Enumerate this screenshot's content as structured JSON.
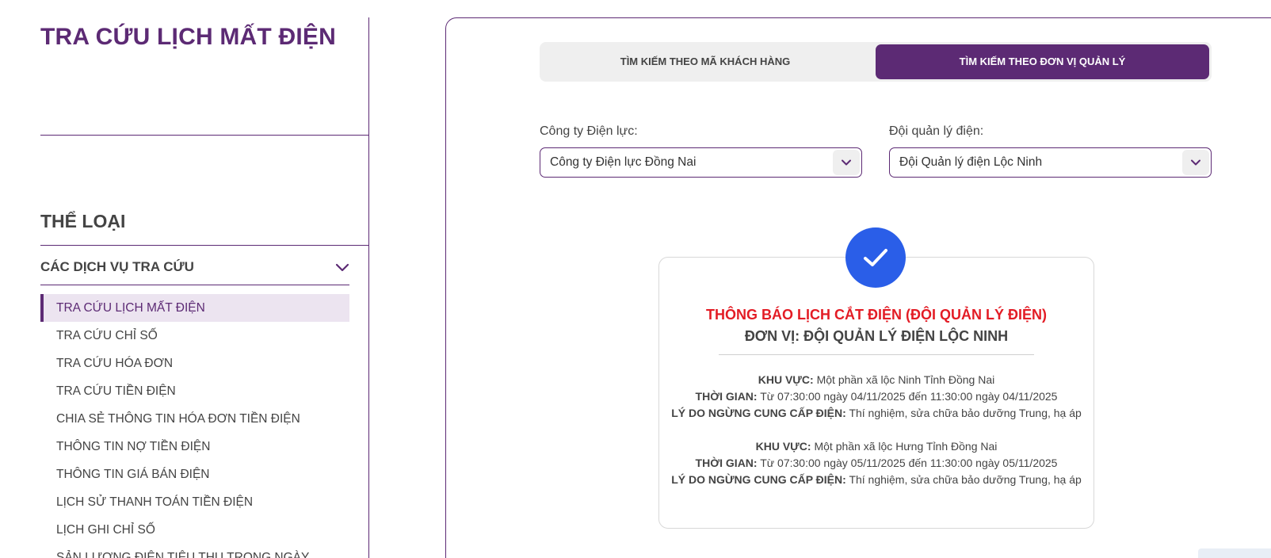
{
  "sidebar": {
    "page_title": "TRA CỨU LỊCH MẤT ĐIỆN",
    "category_heading": "THỂ LOẠI",
    "group_label": "CÁC DỊCH VỤ TRA CỨU",
    "items": [
      {
        "label": "TRA CỨU LỊCH MẤT ĐIỆN",
        "active": true
      },
      {
        "label": "TRA CỨU CHỈ SỐ"
      },
      {
        "label": "TRA CỨU HÓA ĐƠN"
      },
      {
        "label": "TRA CỨU TIỀN ĐIỆN"
      },
      {
        "label": "CHIA SẺ THÔNG TIN HÓA ĐƠN TIỀN ĐIỆN"
      },
      {
        "label": "THÔNG TIN NỢ TIỀN ĐIỆN"
      },
      {
        "label": "THÔNG TIN GIÁ BÁN ĐIỆN"
      },
      {
        "label": "LỊCH SỬ THANH TOÁN TIỀN ĐIỆN"
      },
      {
        "label": "LỊCH GHI CHỈ SỐ"
      },
      {
        "label": "SẢN LƯỢNG ĐIỆN TIÊU THỤ TRONG NGÀY"
      }
    ]
  },
  "tabs": [
    {
      "label": "TÌM KIẾM THEO MÃ KHÁCH HÀNG",
      "active": false
    },
    {
      "label": "TÌM KIẾM THEO ĐƠN VỊ QUẢN LÝ",
      "active": true
    }
  ],
  "form": {
    "company_label": "Công ty Điện lực:",
    "company_value": "Công ty Điện lực Đồng Nai",
    "team_label": "Đội quản lý điện:",
    "team_value": "Đội Quản lý điện Lộc Ninh"
  },
  "result": {
    "title": "THÔNG BÁO LỊCH CẮT ĐIỆN (ĐỘI QUẢN LÝ ĐIỆN)",
    "unit": "ĐƠN VỊ: ĐỘI QUẢN LÝ ĐIỆN LỘC NINH",
    "area_label": "KHU VỰC:",
    "time_label": "THỜI GIAN:",
    "reason_label": "LÝ DO NGỪNG CUNG CẤP ĐIỆN:",
    "entries": [
      {
        "area": "Một phần xã lộc Ninh Tỉnh Đồng Nai",
        "time": "Từ 07:30:00 ngày 04/11/2025 đến 11:30:00 ngày 04/11/2025",
        "reason": "Thí nghiệm, sửa chữa bảo dưỡng Trung, hạ áp"
      },
      {
        "area": "Một phần xã lộc Hưng Tỉnh Đồng Nai",
        "time": "Từ 07:30:00 ngày 05/11/2025 đến 11:30:00 ngày 05/11/2025",
        "reason": "Thí nghiệm, sửa chữa bảo dưỡng Trung, hạ áp"
      }
    ]
  },
  "icons": {
    "dropdown": "chevron-down-icon",
    "success": "checkmark-icon"
  },
  "colors": {
    "brand_purple": "#5c2a74",
    "alert_red": "#e31c25",
    "success_blue": "#2a5ee8",
    "active_item_bg": "#ece4f0"
  }
}
